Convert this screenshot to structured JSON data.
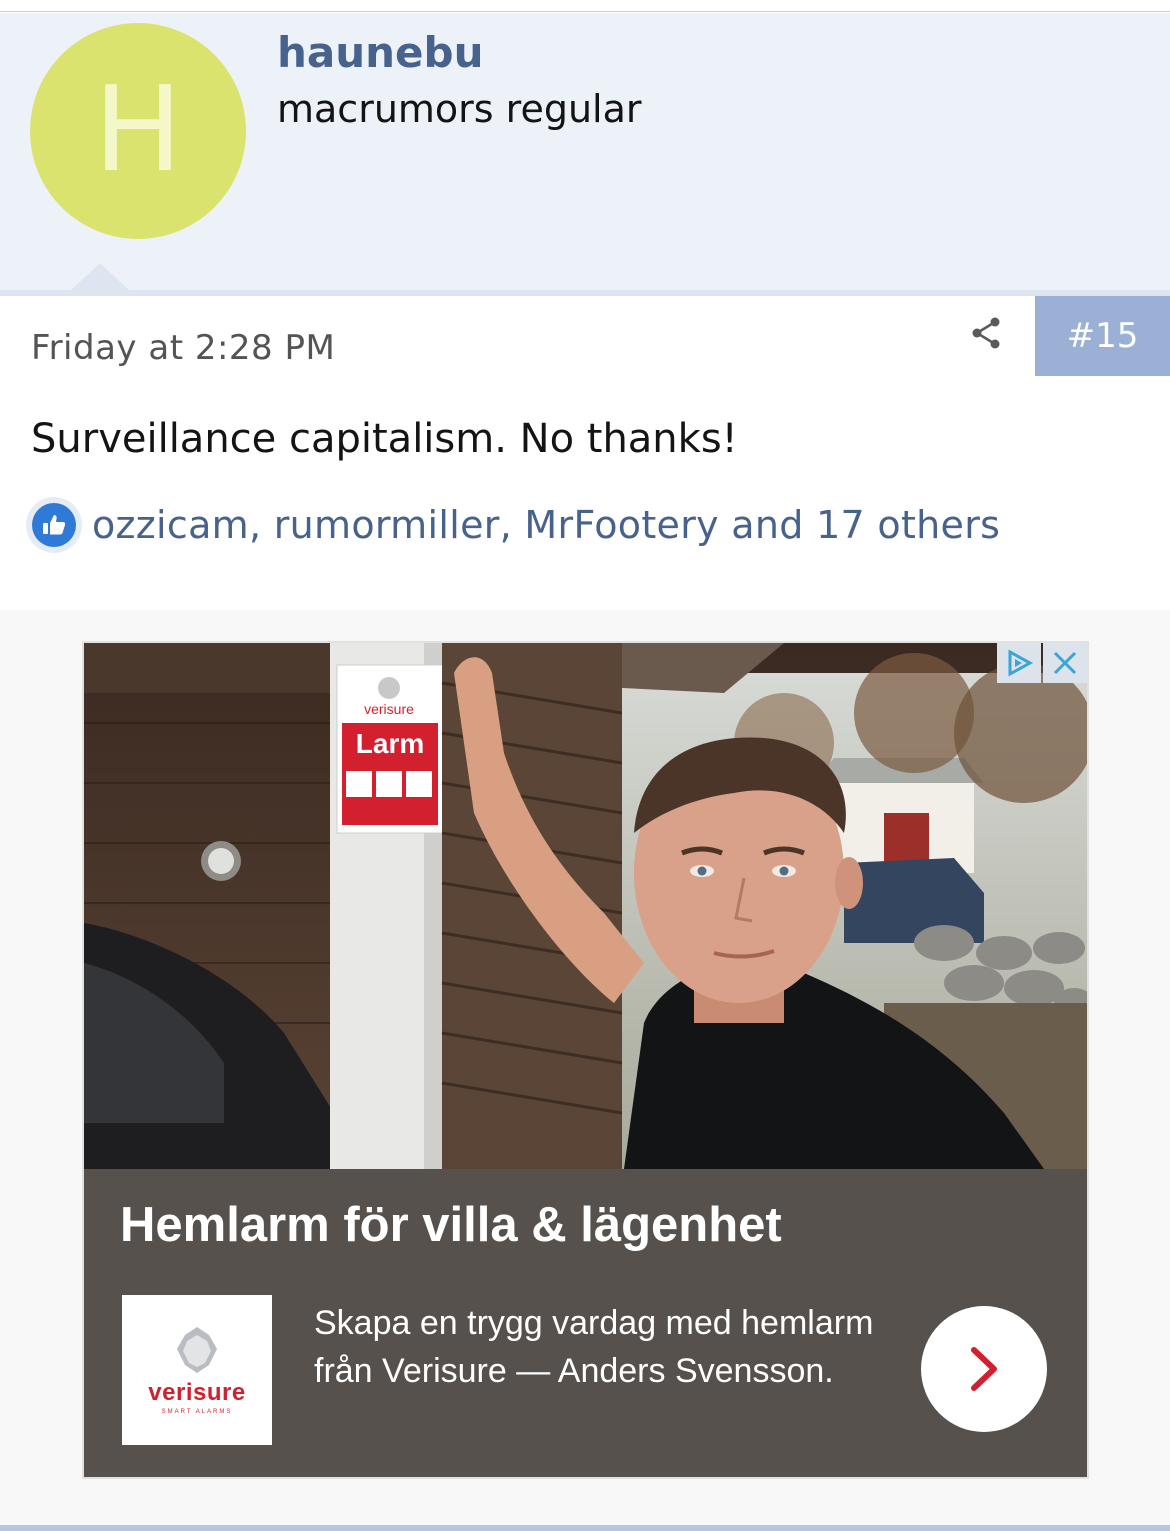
{
  "user": {
    "avatar_letter": "H",
    "avatar_color": "#dbe36f",
    "name": "haunebu",
    "title": "macrumors regular"
  },
  "post": {
    "date": "Friday at 2:28 PM",
    "number": "#15",
    "body": "Surveillance capitalism. No thanks!",
    "share_icon": "share-icon",
    "reactions": {
      "icon": "thumbs-up-icon",
      "text": "ozzicam, rumormiller, MrFootery and 17 others"
    }
  },
  "ad": {
    "headline": "Hemlarm för villa & lägenhet",
    "description": "Skapa en trygg vardag med hemlarm från Verisure — Anders Svensson.",
    "logo_text": "verisure",
    "logo_sub": "SMART ALARMS",
    "sign_brand": "verisure",
    "sign_label": "Larm",
    "cta_icon": "chevron-right-icon",
    "adchoices_icon": "adchoices-icon",
    "close_icon": "close-icon"
  },
  "colors": {
    "accent": "#47628c",
    "post_number_bg": "#9ab0d4",
    "header_bg": "#edf1f8",
    "brand_red": "#d3202e"
  }
}
